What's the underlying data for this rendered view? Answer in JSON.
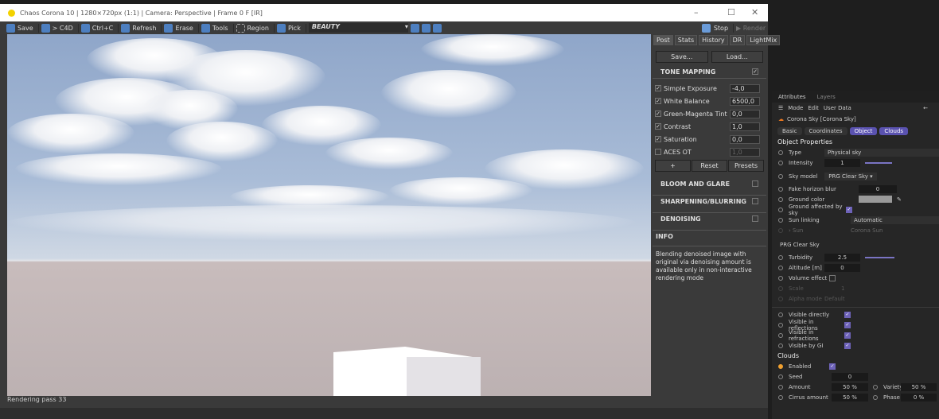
{
  "window": {
    "title": "Chaos Corona 10 | 1280×720px (1:1) | Camera: Perspective | Frame 0 F [IR]",
    "minimize": "–",
    "maximize": "☐",
    "close": "✕"
  },
  "toolbar": {
    "save": "Save",
    "to_c4d": "> C4D",
    "copy": "Ctrl+C",
    "refresh": "Refresh",
    "erase": "Erase",
    "tools": "Tools",
    "region": "Region",
    "pick": "Pick",
    "channel": "BEAUTY",
    "stop": "Stop",
    "render": "Render"
  },
  "status": "Rendering pass 33",
  "post_panel": {
    "tabs": [
      "Post",
      "Stats",
      "History",
      "DR",
      "LightMix"
    ],
    "save": "Save...",
    "load": "Load...",
    "tone_mapping": "TONE MAPPING",
    "params": [
      {
        "label": "Simple Exposure",
        "value": "-4,0",
        "checked": true
      },
      {
        "label": "White Balance",
        "value": "6500,0",
        "checked": true
      },
      {
        "label": "Green-Magenta Tint",
        "value": "0,0",
        "checked": true
      },
      {
        "label": "Contrast",
        "value": "1,0",
        "checked": true
      },
      {
        "label": "Saturation",
        "value": "0,0",
        "checked": true
      },
      {
        "label": "ACES OT",
        "value": "1,0",
        "checked": false
      }
    ],
    "add": "+",
    "reset": "Reset",
    "presets": "Presets",
    "sections": [
      "BLOOM AND GLARE",
      "SHARPENING/BLURRING",
      "DENOISING"
    ],
    "info_title": "INFO",
    "info_text": "Blending denoised image with original via denoising amount is available only in non-interactive rendering mode"
  },
  "attributes": {
    "tabs": [
      "Attributes",
      "Layers"
    ],
    "menu": [
      "Mode",
      "Edit",
      "User Data"
    ],
    "object": "Corona Sky [Corona Sky]",
    "pills": [
      "Basic",
      "Coordinates",
      "Object",
      "Clouds"
    ],
    "section": "Object Properties",
    "type_label": "Type",
    "type_value": "Physical sky",
    "intensity_label": "Intensity",
    "intensity_value": "1",
    "intensity_level": 0.33,
    "sky_model_label": "Sky model",
    "sky_model_value": "PRG Clear Sky",
    "fhb_label": "Fake horizon blur",
    "fhb_value": "0",
    "ground_color_label": "Ground color",
    "gas_label": "Ground affected by sky",
    "sun_linking_label": "Sun linking",
    "sun_linking_value": "Automatic",
    "sun_label": "Sun",
    "sun_value": "Corona Sun",
    "prg_title": "PRG Clear Sky",
    "turbidity_label": "Turbidity",
    "turbidity_value": "2.5",
    "altitude_label": "Altitude [m]",
    "altitude_value": "0",
    "volume_label": "Volume effect",
    "scale_label": "Scale",
    "scale_value": "1",
    "alpha_label": "Alpha mode",
    "alpha_value": "Default",
    "visible": [
      "Visible directly",
      "Visible in reflections",
      "Visible in refractions",
      "Visible by GI"
    ],
    "clouds_title": "Clouds",
    "enabled_label": "Enabled",
    "seed_label": "Seed",
    "seed_value": "0",
    "amount_label": "Amount",
    "amount_value": "50 %",
    "variety_label": "Variety",
    "variety_value": "50 %",
    "cirrus_label": "Cirrus amount",
    "cirrus_value": "50 %",
    "phase_label": "Phase",
    "phase_value": "0 %"
  }
}
